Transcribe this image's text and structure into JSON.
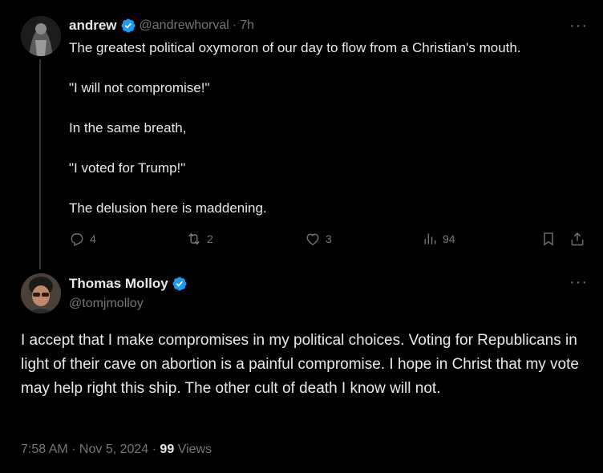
{
  "parent": {
    "name": "andrew",
    "handle": "@andrewhorval",
    "time": "7h",
    "paragraphs": [
      "The greatest political oxymoron of our day to flow from a Christian's mouth.",
      "\"I will not compromise!\"",
      "In the same breath,",
      "\"I voted for Trump!\"",
      "The delusion here is maddening."
    ],
    "actions": {
      "replies": "4",
      "reposts": "2",
      "likes": "3",
      "views": "94"
    }
  },
  "reply": {
    "name": "Thomas Molloy",
    "handle": "@tomjmolloy",
    "text": "I accept that I make compromises in my political choices. Voting for Republicans in light of their cave on abortion is a painful compromise.  I hope in Christ that my vote may help right this ship. The other cult of death I know will not.",
    "timestamp": "7:58 AM · Nov 5, 2024 · ",
    "views_count": "99",
    "views_label": " Views"
  },
  "icons": {
    "verified": "verified-badge-icon",
    "more": "more-options-icon",
    "reply": "reply-icon",
    "repost": "repost-icon",
    "like": "heart-icon",
    "views": "views-chart-icon",
    "bookmark": "bookmark-icon",
    "share": "share-icon"
  },
  "colors": {
    "background": "#000000",
    "text": "#e7e9ea",
    "secondary": "#71767b",
    "verified": "#1d9bf0"
  }
}
